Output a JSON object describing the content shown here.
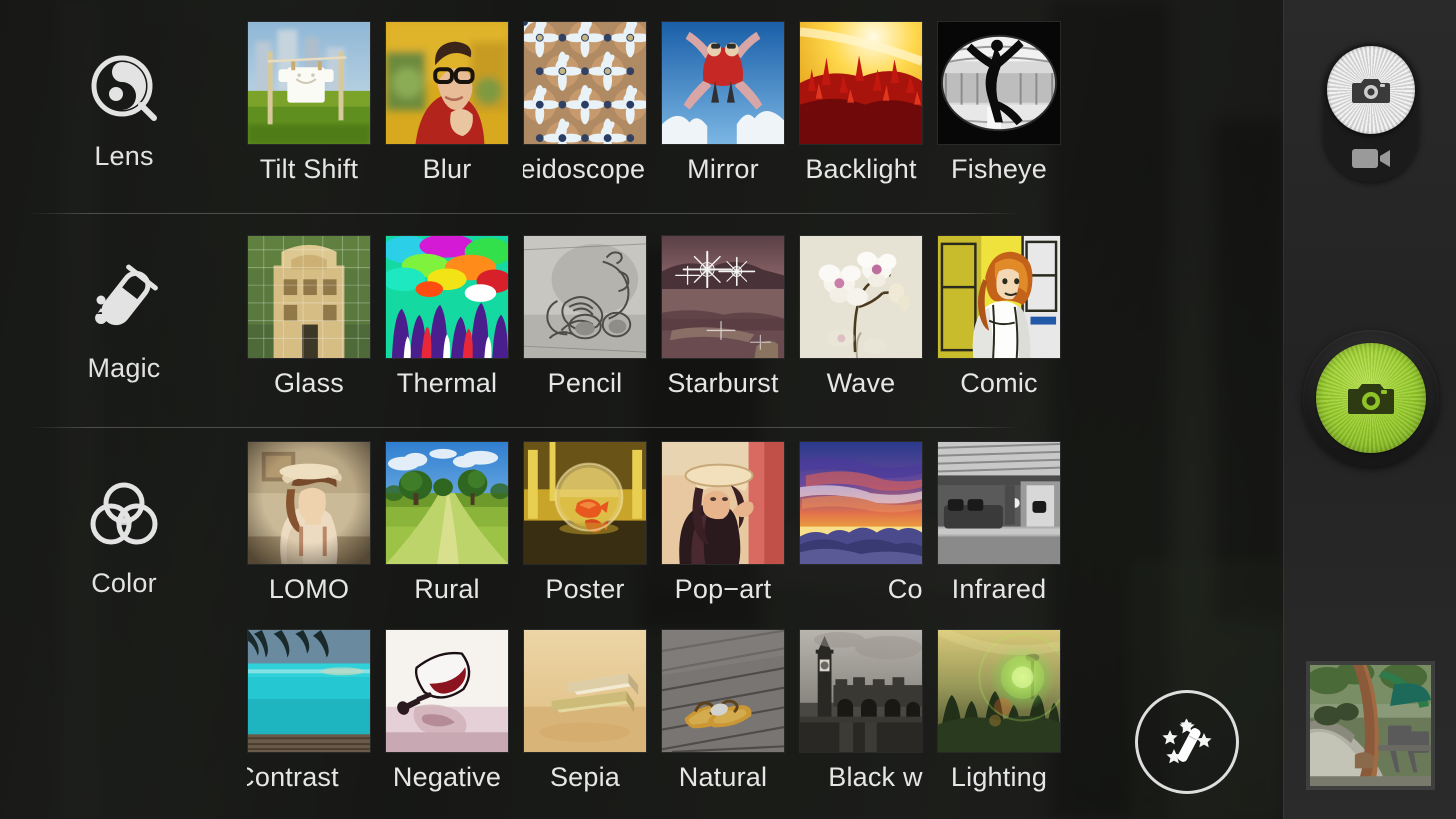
{
  "app": {
    "screen_name": "Camera effects picker"
  },
  "categories": [
    {
      "id": "lens",
      "label": "Lens",
      "icon": "lens-icon"
    },
    {
      "id": "magic",
      "label": "Magic",
      "icon": "test-tube-icon"
    },
    {
      "id": "color",
      "label": "Color",
      "icon": "color-circles-icon"
    }
  ],
  "rows": [
    {
      "category": "Lens",
      "tiles": [
        {
          "label": "Tilt Shift",
          "clipped": false,
          "thumb": "tilt-shift-thumb"
        },
        {
          "label": "Blur",
          "clipped": false,
          "thumb": "blur-thumb"
        },
        {
          "label": "Kaleidoscope",
          "clipped": true,
          "thumb": "kaleidoscope-thumb"
        },
        {
          "label": "Mirror",
          "clipped": false,
          "thumb": "mirror-thumb"
        },
        {
          "label": "Backlight",
          "clipped": false,
          "thumb": "backlight-thumb"
        },
        {
          "label": "Fisheye",
          "clipped": false,
          "thumb": "fisheye-thumb"
        }
      ]
    },
    {
      "category": "Magic",
      "tiles": [
        {
          "label": "Glass",
          "clipped": false,
          "thumb": "glass-thumb"
        },
        {
          "label": "Thermal",
          "clipped": false,
          "thumb": "thermal-thumb"
        },
        {
          "label": "Pencil",
          "clipped": false,
          "thumb": "pencil-thumb"
        },
        {
          "label": "Starburst",
          "clipped": false,
          "thumb": "starburst-thumb"
        },
        {
          "label": "Wave",
          "clipped": false,
          "thumb": "wave-thumb"
        },
        {
          "label": "Comic",
          "clipped": false,
          "thumb": "comic-thumb"
        }
      ]
    },
    {
      "category": "Color",
      "tiles": [
        {
          "label": "LOMO",
          "clipped": false,
          "thumb": "lomo-thumb"
        },
        {
          "label": "Rural",
          "clipped": false,
          "thumb": "rural-thumb"
        },
        {
          "label": "Poster",
          "clipped": false,
          "thumb": "poster-thumb"
        },
        {
          "label": "Pop−art",
          "clipped": false,
          "thumb": "pop-art-thumb"
        },
        {
          "label": "Colors",
          "clipped": true,
          "thumb": "colors-thumb"
        },
        {
          "label": "Infrared",
          "clipped": false,
          "thumb": "infrared-thumb"
        }
      ]
    },
    {
      "category": "Color",
      "tiles": [
        {
          "label": "Contrast",
          "clipped": true,
          "thumb": "contrast-thumb"
        },
        {
          "label": "Negative",
          "clipped": false,
          "thumb": "negative-thumb"
        },
        {
          "label": "Sepia",
          "clipped": false,
          "thumb": "sepia-thumb"
        },
        {
          "label": "Natural",
          "clipped": false,
          "thumb": "natural-thumb"
        },
        {
          "label": "Black white",
          "clipped": true,
          "thumb": "black-white-thumb"
        },
        {
          "label": "Lighting",
          "clipped": false,
          "thumb": "lighting-thumb"
        }
      ]
    }
  ],
  "controls": {
    "magic_wand": {
      "name": "magic-wand-button",
      "icon": "magic-wand-icon"
    },
    "mode_switch": {
      "photo": {
        "icon": "camera-icon",
        "selected": true
      },
      "video": {
        "icon": "video-camera-icon",
        "selected": false
      }
    },
    "shutter": {
      "icon": "camera-icon",
      "color": "#96cc28"
    },
    "last_shot": {
      "name": "last-photo-thumbnail"
    }
  },
  "colors": {
    "shutter_green": "#96cc28",
    "panel_background": "#1e1e1e",
    "label_text": "#e6e6e6"
  }
}
